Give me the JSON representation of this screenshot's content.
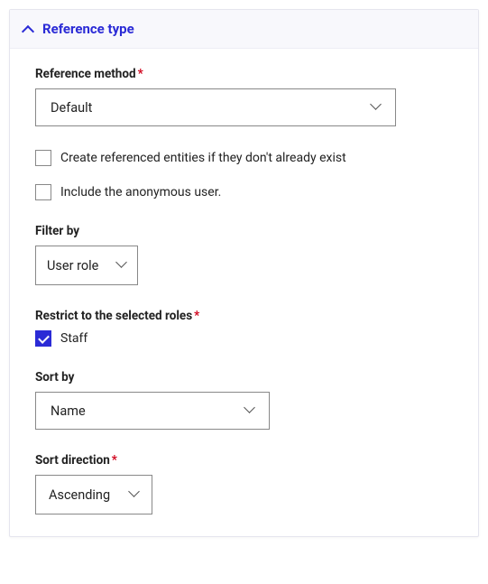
{
  "panel": {
    "title": "Reference type"
  },
  "reference_method": {
    "label": "Reference method",
    "value": "Default"
  },
  "create_entities": {
    "label": "Create referenced entities if they don't already exist"
  },
  "include_anonymous": {
    "label": "Include the anonymous user."
  },
  "filter_by": {
    "label": "Filter by",
    "value": "User role"
  },
  "restrict_roles": {
    "label": "Restrict to the selected roles",
    "options": {
      "staff": "Staff"
    }
  },
  "sort_by": {
    "label": "Sort by",
    "value": "Name"
  },
  "sort_direction": {
    "label": "Sort direction",
    "value": "Ascending"
  }
}
